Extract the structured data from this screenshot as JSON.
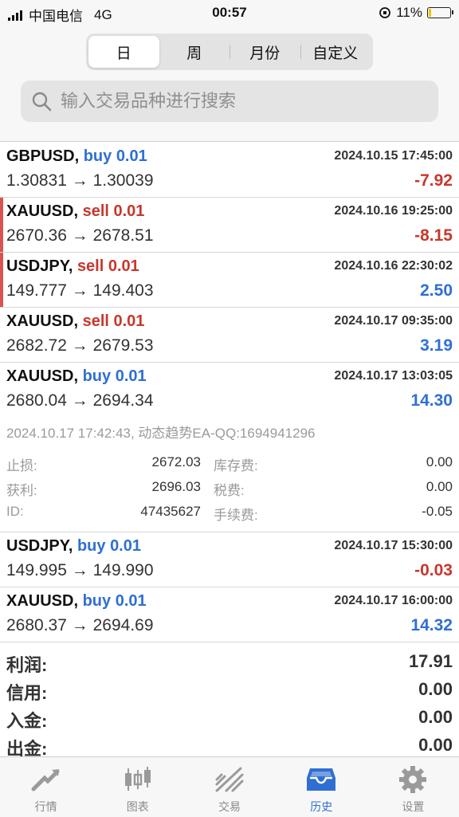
{
  "status": {
    "carrier": "中国电信",
    "network": "4G",
    "time": "00:57",
    "battery": "11%",
    "battery_level": 0.11
  },
  "tabs": [
    "日",
    "周",
    "月份",
    "自定义"
  ],
  "search": {
    "placeholder": "输入交易品种进行搜索"
  },
  "trades": [
    {
      "symbol": "GBPUSD,",
      "side": "buy",
      "lot": "0.01",
      "datetime": "2024.10.15 17:45:00",
      "open": "1.30831",
      "close": "1.30039",
      "profit": "-7.92",
      "marker": false
    },
    {
      "symbol": "XAUUSD,",
      "side": "sell",
      "lot": "0.01",
      "datetime": "2024.10.16 19:25:00",
      "open": "2670.36",
      "close": "2678.51",
      "profit": "-8.15",
      "marker": true
    },
    {
      "symbol": "USDJPY,",
      "side": "sell",
      "lot": "0.01",
      "datetime": "2024.10.16 22:30:02",
      "open": "149.777",
      "close": "149.403",
      "profit": "2.50",
      "marker": true
    },
    {
      "symbol": "XAUUSD,",
      "side": "sell",
      "lot": "0.01",
      "datetime": "2024.10.17 09:35:00",
      "open": "2682.72",
      "close": "2679.53",
      "profit": "3.19",
      "marker": false
    },
    {
      "symbol": "XAUUSD,",
      "side": "buy",
      "lot": "0.01",
      "datetime": "2024.10.17 13:03:05",
      "open": "2680.04",
      "close": "2694.34",
      "profit": "14.30",
      "marker": false
    },
    {
      "symbol": "USDJPY,",
      "side": "buy",
      "lot": "0.01",
      "datetime": "2024.10.17 15:30:00",
      "open": "149.995",
      "close": "149.990",
      "profit": "-0.03",
      "marker": false
    },
    {
      "symbol": "XAUUSD,",
      "side": "buy",
      "lot": "0.01",
      "datetime": "2024.10.17 16:00:00",
      "open": "2680.37",
      "close": "2694.69",
      "profit": "14.32",
      "marker": false
    }
  ],
  "arrow": "→",
  "details": {
    "comment": "2024.10.17 17:42:43, 动态趋势EA-QQ:1694941296",
    "sl_label": "止损:",
    "sl_value": "2672.03",
    "swap_label": "库存费:",
    "swap_value": "0.00",
    "tp_label": "获利:",
    "tp_value": "2696.03",
    "tax_label": "税费:",
    "tax_value": "0.00",
    "id_label": "ID:",
    "id_value": "47435627",
    "fee_label": "手续费:",
    "fee_value": "-0.05"
  },
  "totals": [
    {
      "label": "利润:",
      "value": "17.91"
    },
    {
      "label": "信用:",
      "value": "0.00"
    },
    {
      "label": "入金:",
      "value": "0.00"
    },
    {
      "label": "出金:",
      "value": "0.00"
    }
  ],
  "nav": [
    {
      "label": "行情",
      "icon": "quotes-icon"
    },
    {
      "label": "图表",
      "icon": "chart-icon"
    },
    {
      "label": "交易",
      "icon": "trade-icon"
    },
    {
      "label": "历史",
      "icon": "history-icon",
      "active": true
    },
    {
      "label": "设置",
      "icon": "settings-icon"
    }
  ],
  "colors": {
    "buy": "#2f6fd3",
    "sell": "#c8372c",
    "marker": "#d9534f",
    "active": "#2f6fd3",
    "inactive": "#8a8a8a"
  }
}
